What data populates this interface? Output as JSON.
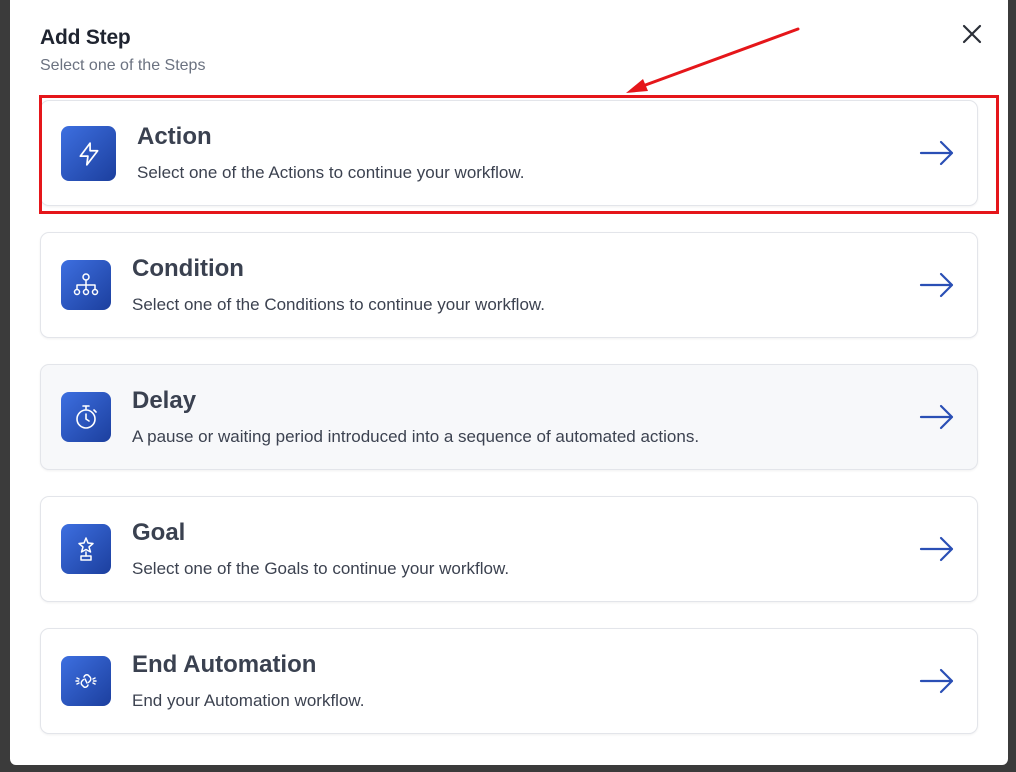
{
  "modal": {
    "title": "Add Step",
    "subtitle": "Select one of the Steps"
  },
  "steps": [
    {
      "title": "Action",
      "description": "Select one of the Actions to continue your workflow.",
      "icon": "lightning-icon"
    },
    {
      "title": "Condition",
      "description": "Select one of the Conditions to continue your workflow.",
      "icon": "hierarchy-icon"
    },
    {
      "title": "Delay",
      "description": "A pause or waiting period introduced into a sequence of automated actions.",
      "icon": "stopwatch-icon"
    },
    {
      "title": "Goal",
      "description": "Select one of the Goals to continue your workflow.",
      "icon": "trophy-icon"
    },
    {
      "title": "End Automation",
      "description": "End your Automation workflow.",
      "icon": "unlink-icon"
    }
  ],
  "colors": {
    "accent": "#2a4fb5",
    "icon_gradient_start": "#3d6fe0",
    "icon_gradient_end": "#1c3f9e",
    "annotation_red": "#e5161a"
  }
}
